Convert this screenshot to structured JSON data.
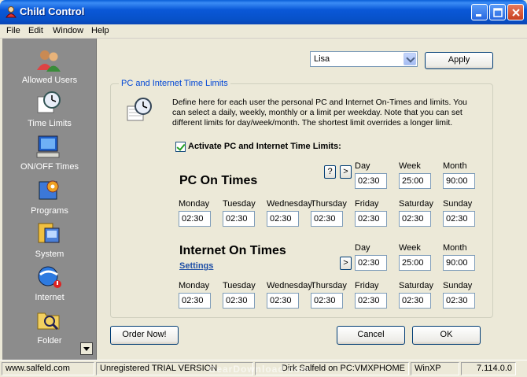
{
  "window": {
    "title": "Child Control"
  },
  "menu": [
    "File",
    "Edit",
    "Window",
    "Help"
  ],
  "sidebar": {
    "items": [
      {
        "label": "Allowed Users",
        "icon": "users-icon"
      },
      {
        "label": "Time Limits",
        "icon": "clock-icon"
      },
      {
        "label": "ON/OFF Times",
        "icon": "computer-icon"
      },
      {
        "label": "Programs",
        "icon": "programs-icon"
      },
      {
        "label": "System",
        "icon": "system-icon"
      },
      {
        "label": "Internet",
        "icon": "internet-icon"
      },
      {
        "label": "Folder",
        "icon": "folder-icon"
      }
    ]
  },
  "user": {
    "selected": "Lisa",
    "apply_label": "Apply"
  },
  "group": {
    "title": "PC and Internet Time Limits",
    "description": "Define here for each user the personal PC and Internet On-Times and limits. You can select a daily, weekly, monthly or a limit per weekday. Note that you can set different limits for day/week/month. The shortest limit overrides a longer limit.",
    "activate_label": "Activate PC and Internet Time Limits:",
    "activate_checked": true
  },
  "pc": {
    "title": "PC On Times",
    "help_label": "?",
    "more_label": ">",
    "period_labels": [
      "Day",
      "Week",
      "Month"
    ],
    "period_values": [
      "02:30",
      "25:00",
      "90:00"
    ],
    "weekday_labels": [
      "Monday",
      "Tuesday",
      "Wednesday",
      "Thursday",
      "Friday",
      "Saturday",
      "Sunday"
    ],
    "weekday_values": [
      "02:30",
      "02:30",
      "02:30",
      "02:30",
      "02:30",
      "02:30",
      "02:30"
    ]
  },
  "internet": {
    "title": "Internet On Times",
    "settings_label": "Settings",
    "more_label": ">",
    "period_labels": [
      "Day",
      "Week",
      "Month"
    ],
    "period_values": [
      "02:30",
      "25:00",
      "90:00"
    ],
    "weekday_labels": [
      "Monday",
      "Tuesday",
      "Wednesday",
      "Thursday",
      "Friday",
      "Saturday",
      "Sunday"
    ],
    "weekday_values": [
      "02:30",
      "02:30",
      "02:30",
      "02:30",
      "02:30",
      "02:30",
      "02:30"
    ]
  },
  "buttons": {
    "order": "Order Now!",
    "cancel": "Cancel",
    "ok": "OK"
  },
  "status": {
    "website": "www.salfeld.com",
    "license": "Unregistered TRIAL VERSION",
    "user": "Dirk Salfeld on PC:VMXPHOME",
    "os": "WinXP",
    "version": "7.114.0.0",
    "watermark": "GearDownload.com"
  },
  "colors": {
    "titlebar": "#0a58d8",
    "sidebar": "#8c8c8c",
    "link": "#1f4fa6",
    "group_title": "#0046d5"
  }
}
